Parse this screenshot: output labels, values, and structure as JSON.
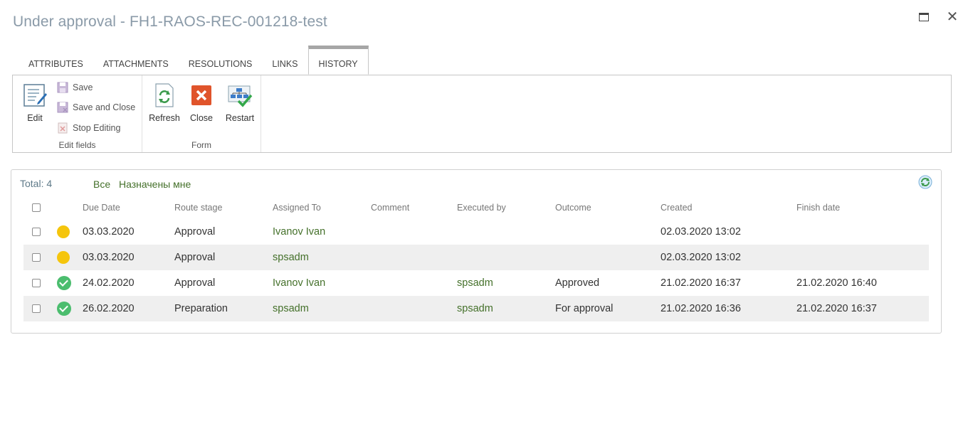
{
  "window": {
    "title": "Under approval - FH1-RAOS-REC-001218-test"
  },
  "tabs": [
    {
      "label": "ATTRIBUTES"
    },
    {
      "label": "ATTACHMENTS"
    },
    {
      "label": "RESOLUTIONS"
    },
    {
      "label": "LINKS"
    },
    {
      "label": "HISTORY",
      "active": true
    }
  ],
  "ribbon": {
    "edit_fields": {
      "group_label": "Edit fields",
      "edit": "Edit",
      "save": "Save",
      "save_close": "Save and Close",
      "stop_editing": "Stop Editing"
    },
    "form": {
      "group_label": "Form",
      "refresh": "Refresh",
      "close": "Close",
      "restart": "Restart"
    }
  },
  "history": {
    "total_label": "Total: 4",
    "filters": {
      "all": "Все",
      "assigned_to_me": "Назначены мне"
    },
    "columns": {
      "due_date": "Due Date",
      "route_stage": "Route stage",
      "assigned_to": "Assigned To",
      "comment": "Comment",
      "executed_by": "Executed by",
      "outcome": "Outcome",
      "created": "Created",
      "finish_date": "Finish date"
    },
    "rows": [
      {
        "status": "pending",
        "due_date": "03.03.2020",
        "route_stage": "Approval",
        "assigned_to": "Ivanov Ivan",
        "comment": "",
        "executed_by": "",
        "outcome": "",
        "created": "02.03.2020 13:02",
        "finish_date": ""
      },
      {
        "status": "pending",
        "due_date": "03.03.2020",
        "route_stage": "Approval",
        "assigned_to": "spsadm",
        "comment": "",
        "executed_by": "",
        "outcome": "",
        "created": "02.03.2020 13:02",
        "finish_date": ""
      },
      {
        "status": "done",
        "due_date": "24.02.2020",
        "route_stage": "Approval",
        "assigned_to": "Ivanov Ivan",
        "comment": "",
        "executed_by": "spsadm",
        "outcome": "Approved",
        "created": "21.02.2020 16:37",
        "finish_date": "21.02.2020 16:40"
      },
      {
        "status": "done",
        "due_date": "26.02.2020",
        "route_stage": "Preparation",
        "assigned_to": "spsadm",
        "comment": "",
        "executed_by": "spsadm",
        "outcome": "For approval",
        "created": "21.02.2020 16:36",
        "finish_date": "21.02.2020 16:37"
      }
    ]
  },
  "colors": {
    "pending": "#f5c50c",
    "done": "#4bbd6e",
    "link_green": "#44702a",
    "title_gray": "#8a9aa8"
  }
}
